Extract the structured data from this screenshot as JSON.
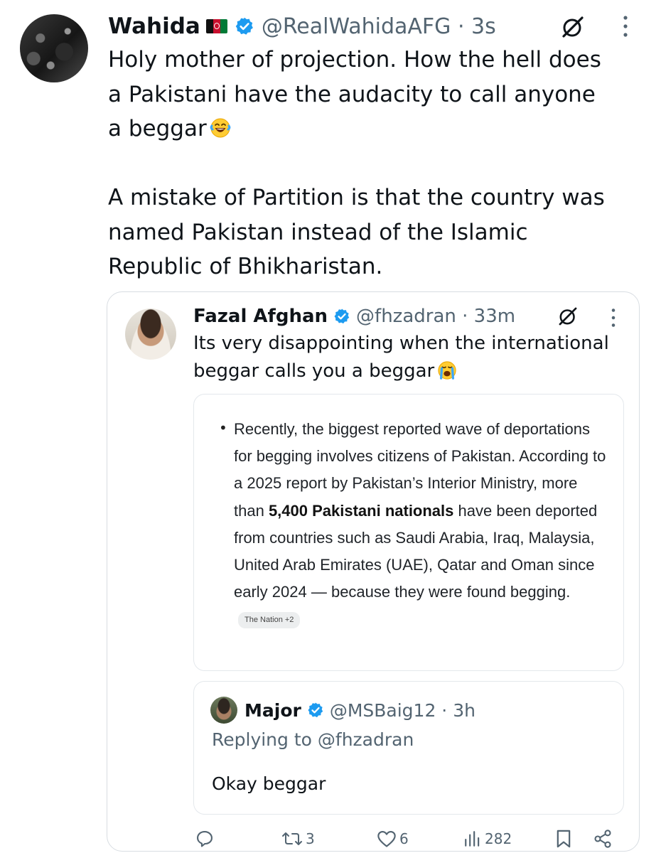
{
  "main_tweet": {
    "author_name": "Wahida",
    "handle_time": "@RealWahidaAFG · 3s",
    "text_line1": "Holy mother of projection. How the hell does\na Pakistani have the audacity to call anyone\na beggar",
    "text_line2": "\n\nA mistake of Partition is that the country was\nnamed Pakistan instead of the Islamic\nRepublic of Bhikharistan.",
    "icons": [
      "afghanistan-flag-icon",
      "verified-badge-icon",
      "grok-icon",
      "more-options-icon",
      "laughing-emoji-icon"
    ]
  },
  "quoted_tweet": {
    "author_name": "Fazal Afghan",
    "handle_time": "@fhzadran · 33m",
    "text": "Its very disappointing when the international\nbeggar calls you a beggar",
    "icons": [
      "verified-badge-icon",
      "grok-icon",
      "more-options-icon",
      "crying-emoji-icon"
    ]
  },
  "answer_card": {
    "bullet": "•",
    "text_before": "Recently, the biggest reported wave of deportations for begging involves citizens of Pakistan. According to a 2025 report by Pakistan’s Interior Ministry, more than ",
    "bold_text": "5,400 Pakistani nationals",
    "text_after": " have been deported from countries such as Saudi Arabia, Iraq, Malaysia, United Arab Emirates (UAE), Qatar and Oman since early 2024 — because they were found begging.",
    "source_chip": "The Nation +2"
  },
  "nested_reply": {
    "author_name": "Major",
    "handle_time": "@MSBaig12 · 3h",
    "replying_to": "Replying to @fhzadran",
    "text": "Okay beggar"
  },
  "actions": {
    "reply_count": "",
    "retweet_count": "3",
    "like_count": "6",
    "views_count": "282"
  },
  "colors": {
    "text": "#0f1419",
    "secondary": "#536471",
    "verified": "#1d9bf0",
    "border": "#d8dde2"
  }
}
